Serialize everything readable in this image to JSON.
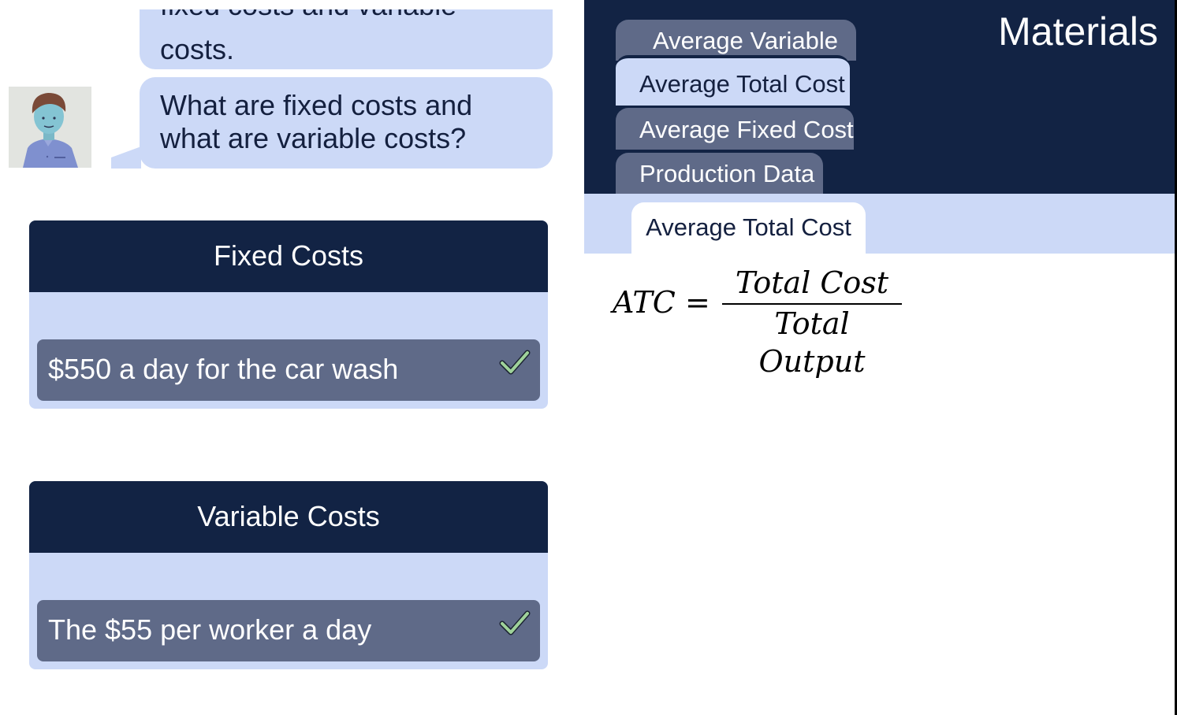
{
  "chat": {
    "previous_message": {
      "line_cut": "fixed costs and variable",
      "line_last": "costs."
    },
    "question": "What are fixed costs and what are variable costs?"
  },
  "cost_cards": {
    "fixed": {
      "header": "Fixed Costs",
      "answer": "$550 a day for the car wash"
    },
    "variable": {
      "header": "Variable Costs",
      "answer": "The $55 per worker a day"
    }
  },
  "materials": {
    "title": "Materials",
    "tabs": [
      {
        "label": "Average Variable"
      },
      {
        "label": "Average Total Cost"
      },
      {
        "label": "Average Fixed Cost"
      },
      {
        "label": "Production Data"
      }
    ],
    "active_subtab": "Average Total Cost",
    "formula": {
      "lhs": "ATC",
      "equals": "=",
      "numerator": "Total Cost",
      "denominator": "Total Output"
    }
  },
  "icons": {
    "avatar": "student-avatar",
    "check": "check-icon"
  },
  "colors": {
    "navy": "#122344",
    "light_blue": "#ccd9f7",
    "slate": "#5f6a88",
    "check_green": "#9fd29a"
  }
}
